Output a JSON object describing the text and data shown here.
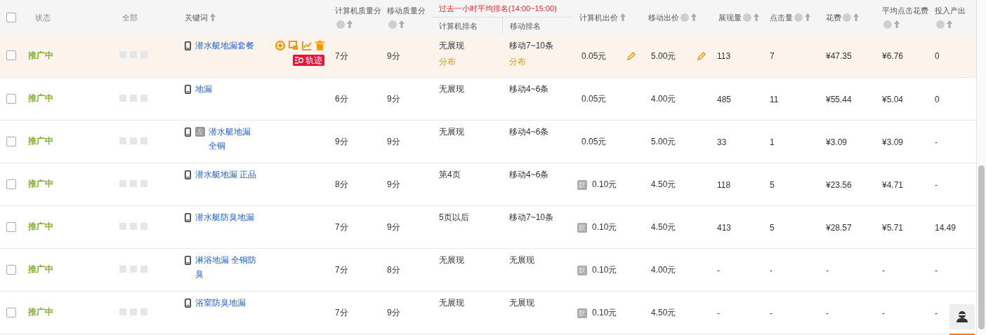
{
  "header": {
    "checked": false,
    "columns": [
      {
        "kind": "plain",
        "label": "状态"
      },
      {
        "kind": "plain",
        "label": "全部"
      },
      {
        "kind": "plain",
        "label": "关键词",
        "sort": true
      },
      {
        "kind": "plain",
        "label": "计算机质量分",
        "help": true,
        "sort": true
      },
      {
        "kind": "plain",
        "label": "移动质量分",
        "help": true,
        "sort": true
      },
      {
        "kind": "group",
        "label": "过去一小时平均排名(14:00~15:00)",
        "children": [
          "计算机排名",
          "移动排名"
        ]
      },
      {
        "kind": "plain",
        "label": "计算机出价",
        "sort": true
      },
      {
        "kind": "plain",
        "label": "移动出价",
        "help": true,
        "sort": true
      },
      {
        "kind": "plain",
        "label": "展现量",
        "help": true,
        "sort": true
      },
      {
        "kind": "plain",
        "label": "点击量",
        "help": true,
        "sort": true
      },
      {
        "kind": "plain",
        "label": "花费",
        "help": true,
        "sort": true
      },
      {
        "kind": "plain",
        "label": "平均点击花费",
        "help": true,
        "sort": true
      },
      {
        "kind": "plain",
        "label": "投入产出",
        "help": true,
        "sort": true
      }
    ]
  },
  "rows": [
    {
      "checked": false,
      "hovered": true,
      "status": "推广中",
      "keyword": {
        "text": "潜水艇地漏套餐",
        "track": "轨迹"
      },
      "pc_quality": "7分",
      "m_quality": "9分",
      "pc_rank": {
        "text": "无展现",
        "link": "分布"
      },
      "m_rank": {
        "text": "移动7~10条",
        "link": "分布"
      },
      "pc_bid": {
        "value": "0.05元"
      },
      "m_bid": {
        "value": "5.00元"
      },
      "impressions": "113",
      "clicks": "7",
      "cost": "¥47.35",
      "avg_cpc": "¥6.76",
      "roi": "0"
    },
    {
      "checked": false,
      "hovered": false,
      "status": "推广中",
      "keyword": {
        "text": "地漏"
      },
      "pc_quality": "6分",
      "m_quality": "9分",
      "pc_rank": {
        "text": "无展现"
      },
      "m_rank": {
        "text": "移动4~6条"
      },
      "pc_bid": {
        "value": "0.05元"
      },
      "m_bid": {
        "value": "4.00元"
      },
      "impressions": "485",
      "clicks": "11",
      "cost": "¥55.44",
      "avg_cpc": "¥5.04",
      "roi": "0"
    },
    {
      "checked": false,
      "hovered": false,
      "status": "推广中",
      "keyword": {
        "text": "潜水艇地漏全铜",
        "badge": "左"
      },
      "pc_quality": "9分",
      "m_quality": "9分",
      "pc_rank": {
        "text": "无展现"
      },
      "m_rank": {
        "text": "移动4~6条"
      },
      "pc_bid": {
        "value": "0.05元"
      },
      "m_bid": {
        "value": "5.00元"
      },
      "impressions": "33",
      "clicks": "1",
      "cost": "¥3.09",
      "avg_cpc": "¥3.09",
      "roi": "-"
    },
    {
      "checked": false,
      "hovered": false,
      "status": "推广中",
      "keyword": {
        "text": "潜水艇地漏 正品"
      },
      "pc_quality": "8分",
      "m_quality": "9分",
      "pc_rank": {
        "text": "第4页"
      },
      "m_rank": {
        "text": "移动4~6条"
      },
      "pc_bid": {
        "badge": "默",
        "value": "0.10元"
      },
      "m_bid": {
        "value": "4.50元"
      },
      "impressions": "118",
      "clicks": "5",
      "cost": "¥23.56",
      "avg_cpc": "¥4.71",
      "roi": "-"
    },
    {
      "checked": false,
      "hovered": false,
      "status": "推广中",
      "keyword": {
        "text": "潜水艇防臭地漏"
      },
      "pc_quality": "7分",
      "m_quality": "9分",
      "pc_rank": {
        "text": "5页以后"
      },
      "m_rank": {
        "text": "移动7~10条"
      },
      "pc_bid": {
        "badge": "默",
        "value": "0.10元"
      },
      "m_bid": {
        "value": "4.50元"
      },
      "impressions": "413",
      "clicks": "5",
      "cost": "¥28.57",
      "avg_cpc": "¥5.71",
      "roi": "14.49"
    },
    {
      "checked": false,
      "hovered": false,
      "status": "推广中",
      "keyword": {
        "text": "淋浴地漏 全铜防臭"
      },
      "pc_quality": "7分",
      "m_quality": "8分",
      "pc_rank": {
        "text": "无展现"
      },
      "m_rank": {
        "text": "无展现"
      },
      "pc_bid": {
        "badge": "默",
        "value": "0.10元"
      },
      "m_bid": {
        "value": "4.00元"
      },
      "impressions": "-",
      "clicks": "-",
      "cost": "-",
      "avg_cpc": "-",
      "roi": "-"
    },
    {
      "checked": false,
      "hovered": false,
      "status": "推广中",
      "keyword": {
        "text": "浴室防臭地漏"
      },
      "pc_quality": "7分",
      "m_quality": "9分",
      "pc_rank": {
        "text": "无展现"
      },
      "m_rank": {
        "text": "无展现"
      },
      "pc_bid": {
        "badge": "默",
        "value": "0.10元"
      },
      "m_bid": {
        "value": "4.50元"
      },
      "impressions": "-",
      "clicks": "-",
      "cost": "-",
      "avg_cpc": "-",
      "roi": "-"
    }
  ]
}
